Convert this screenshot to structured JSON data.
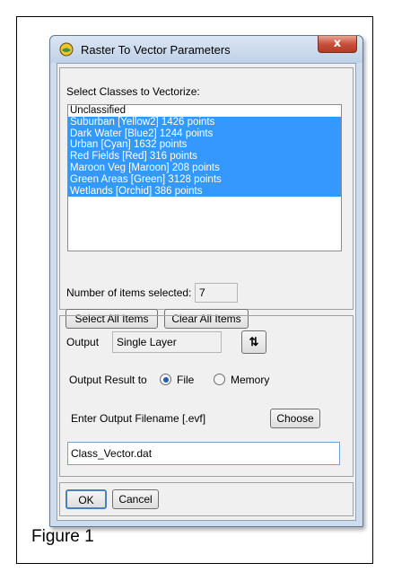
{
  "window": {
    "title": "Raster To Vector Parameters",
    "close_label": "x"
  },
  "classes_section": {
    "heading": "Select Classes to Vectorize:",
    "items": [
      {
        "label": "Unclassified",
        "selected": false
      },
      {
        "label": "Suburban [Yellow2] 1426 points",
        "selected": true
      },
      {
        "label": "Dark Water [Blue2] 1244 points",
        "selected": true
      },
      {
        "label": "Urban [Cyan] 1632 points",
        "selected": true
      },
      {
        "label": "Red Fields [Red] 316 points",
        "selected": true
      },
      {
        "label": "Maroon Veg [Maroon] 208 points",
        "selected": true
      },
      {
        "label": "Green Areas [Green] 3128 points",
        "selected": true
      },
      {
        "label": "Wetlands [Orchid] 386 points",
        "selected": true
      }
    ],
    "count_label": "Number of items selected:",
    "count_value": "7",
    "select_all_label": "Select All Items",
    "clear_all_label": "Clear All Items"
  },
  "output_section": {
    "output_label": "Output",
    "output_value": "Single Layer",
    "toggle_icon": "sort-toggle-icon",
    "result_to_label": "Output Result to",
    "file_label": "File",
    "memory_label": "Memory",
    "file_selected": true,
    "filename_label": "Enter Output Filename [.evf]",
    "choose_label": "Choose",
    "filename_value": "Class_Vector.dat"
  },
  "footer": {
    "ok_label": "OK",
    "cancel_label": "Cancel"
  },
  "caption": "Figure 1"
}
